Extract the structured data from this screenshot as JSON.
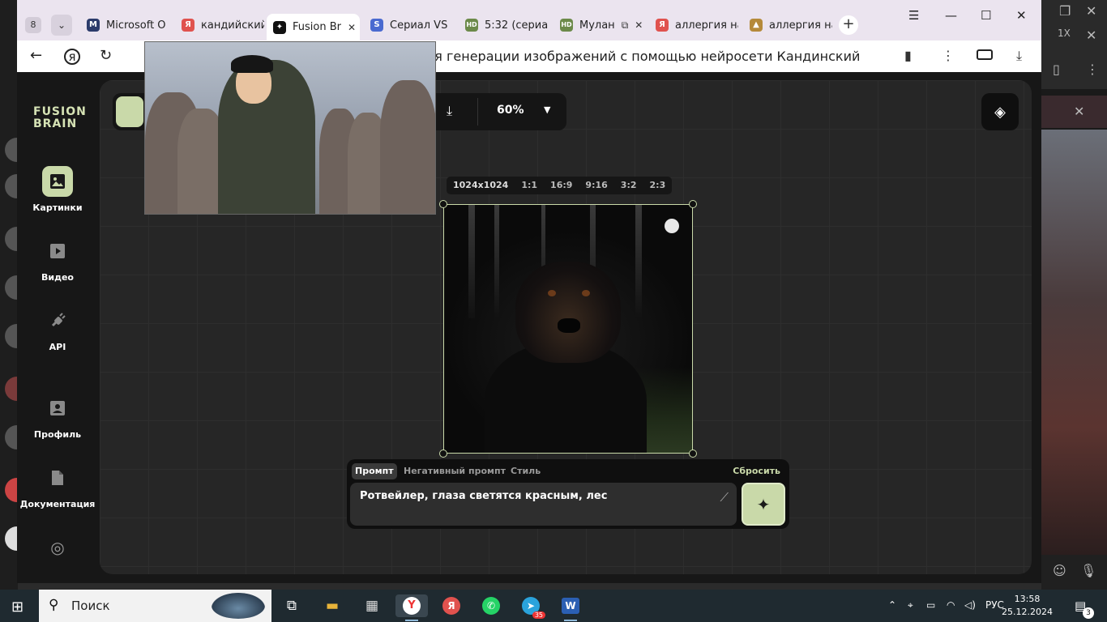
{
  "browser": {
    "tab_count": "8",
    "tabs": [
      {
        "label": "Microsoft O",
        "fav_color": "#2b3b6b",
        "fav_glyph": "M"
      },
      {
        "label": "кандийский",
        "fav_color": "#e0524e",
        "fav_glyph": "Я"
      },
      {
        "label": "Fusion Br",
        "fav_color": "#111111",
        "fav_glyph": "✦",
        "active": true
      },
      {
        "label": "Сериал VS",
        "fav_color": "#4a6ad0",
        "fav_glyph": "S"
      },
      {
        "label": "5:32 (сериа",
        "fav_color": "#6c8a4a",
        "fav_glyph": "HD"
      },
      {
        "label": "Мулан",
        "fav_color": "#6c8a4a",
        "fav_glyph": "HD"
      },
      {
        "label": "аллергия на",
        "fav_color": "#e0524e",
        "fav_glyph": "Я"
      },
      {
        "label": "аллергия на",
        "fav_color": "#b58a3a",
        "fav_glyph": "▲"
      }
    ],
    "url": "для генерации изображений с помощью нейросети Кандинский"
  },
  "sidebar": {
    "logo_line1": "FUSION",
    "logo_line2": "BRAIN",
    "items": [
      {
        "label": "Картинки",
        "icon": "image-icon"
      },
      {
        "label": "Видео",
        "icon": "play-icon"
      },
      {
        "label": "API",
        "icon": "plug-icon"
      },
      {
        "label": "Профиль",
        "icon": "profile-icon"
      },
      {
        "label": "Документация",
        "icon": "document-icon"
      }
    ]
  },
  "toolbar": {
    "zoom": "60%"
  },
  "ratios": [
    "1024x1024",
    "1:1",
    "16:9",
    "9:16",
    "3:2",
    "2:3"
  ],
  "prompt": {
    "tabs": [
      "Промпт",
      "Негативный промпт",
      "Стиль"
    ],
    "reset_label": "Сбросить",
    "value": "Ротвейлер, глаза светятся красным, лес"
  },
  "taskbar": {
    "search_placeholder": "Поиск",
    "language": "РУС",
    "time": "13:58",
    "date": "25.12.2024",
    "notifications": "3",
    "telegram_badge": "35"
  },
  "colors": {
    "accent": "#c9d9a9",
    "canvas_bg": "#262626",
    "page_bg": "#171717"
  }
}
